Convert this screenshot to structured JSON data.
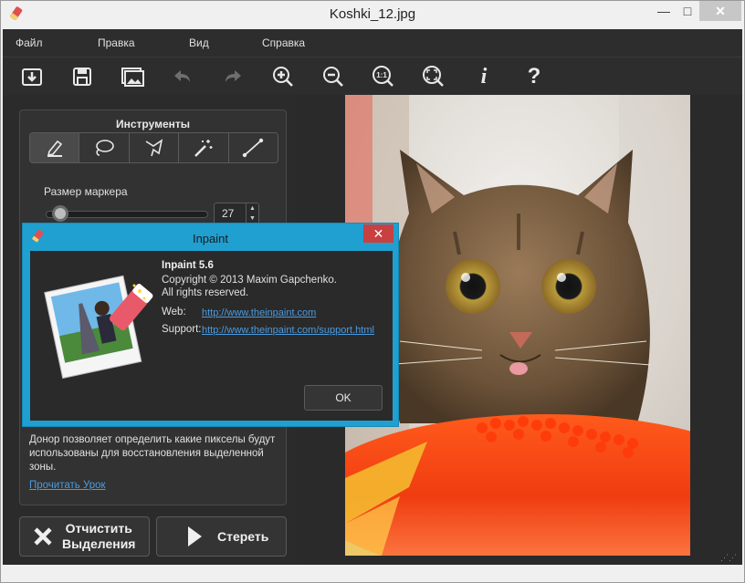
{
  "window": {
    "title": "Koshki_12.jpg",
    "minimize": "—",
    "maximize": "□",
    "close": "✕"
  },
  "menu": {
    "items": [
      "Файл",
      "Правка",
      "Вид",
      "Справка"
    ]
  },
  "toolbar": {
    "buttons": [
      "open-icon",
      "save-icon",
      "image-icon",
      "undo-icon",
      "redo-icon",
      "zoom-in-icon",
      "zoom-out-icon",
      "zoom-actual-icon",
      "zoom-fit-icon",
      "info-icon",
      "help-icon"
    ],
    "zoom_actual_label": "1:1",
    "info_label": "i",
    "help_label": "?"
  },
  "panel": {
    "title": "Инструменты",
    "tools": [
      "marker-icon",
      "lasso-icon",
      "polygonal-lasso-icon",
      "magic-wand-icon",
      "line-icon"
    ],
    "size_label": "Размер маркера",
    "size_value": "27",
    "size_fraction": 0.04,
    "description": "Донор позволяет определить какие пикселы будут использованы для восстановления выделенной зоны.",
    "lesson_link": "Прочитать Урок"
  },
  "actions": {
    "clear_line1": "Отчистить",
    "clear_line2": "Выделения",
    "erase": "Стереть"
  },
  "dialog": {
    "title": "Inpaint",
    "close": "✕",
    "heading": "Inpaint 5.6",
    "copyright": "Copyright © 2013 Maxim Gapchenko.",
    "rights": "All rights reserved.",
    "web_label": "Web:",
    "web_url": "http://www.theinpaint.com",
    "support_label": "Support:",
    "support_url": "http://www.theinpaint.com/support.html",
    "ok": "OK"
  },
  "colors": {
    "accent": "#1fa0d0",
    "link": "#4a9be0",
    "dark_bg": "#2b2b2b"
  }
}
